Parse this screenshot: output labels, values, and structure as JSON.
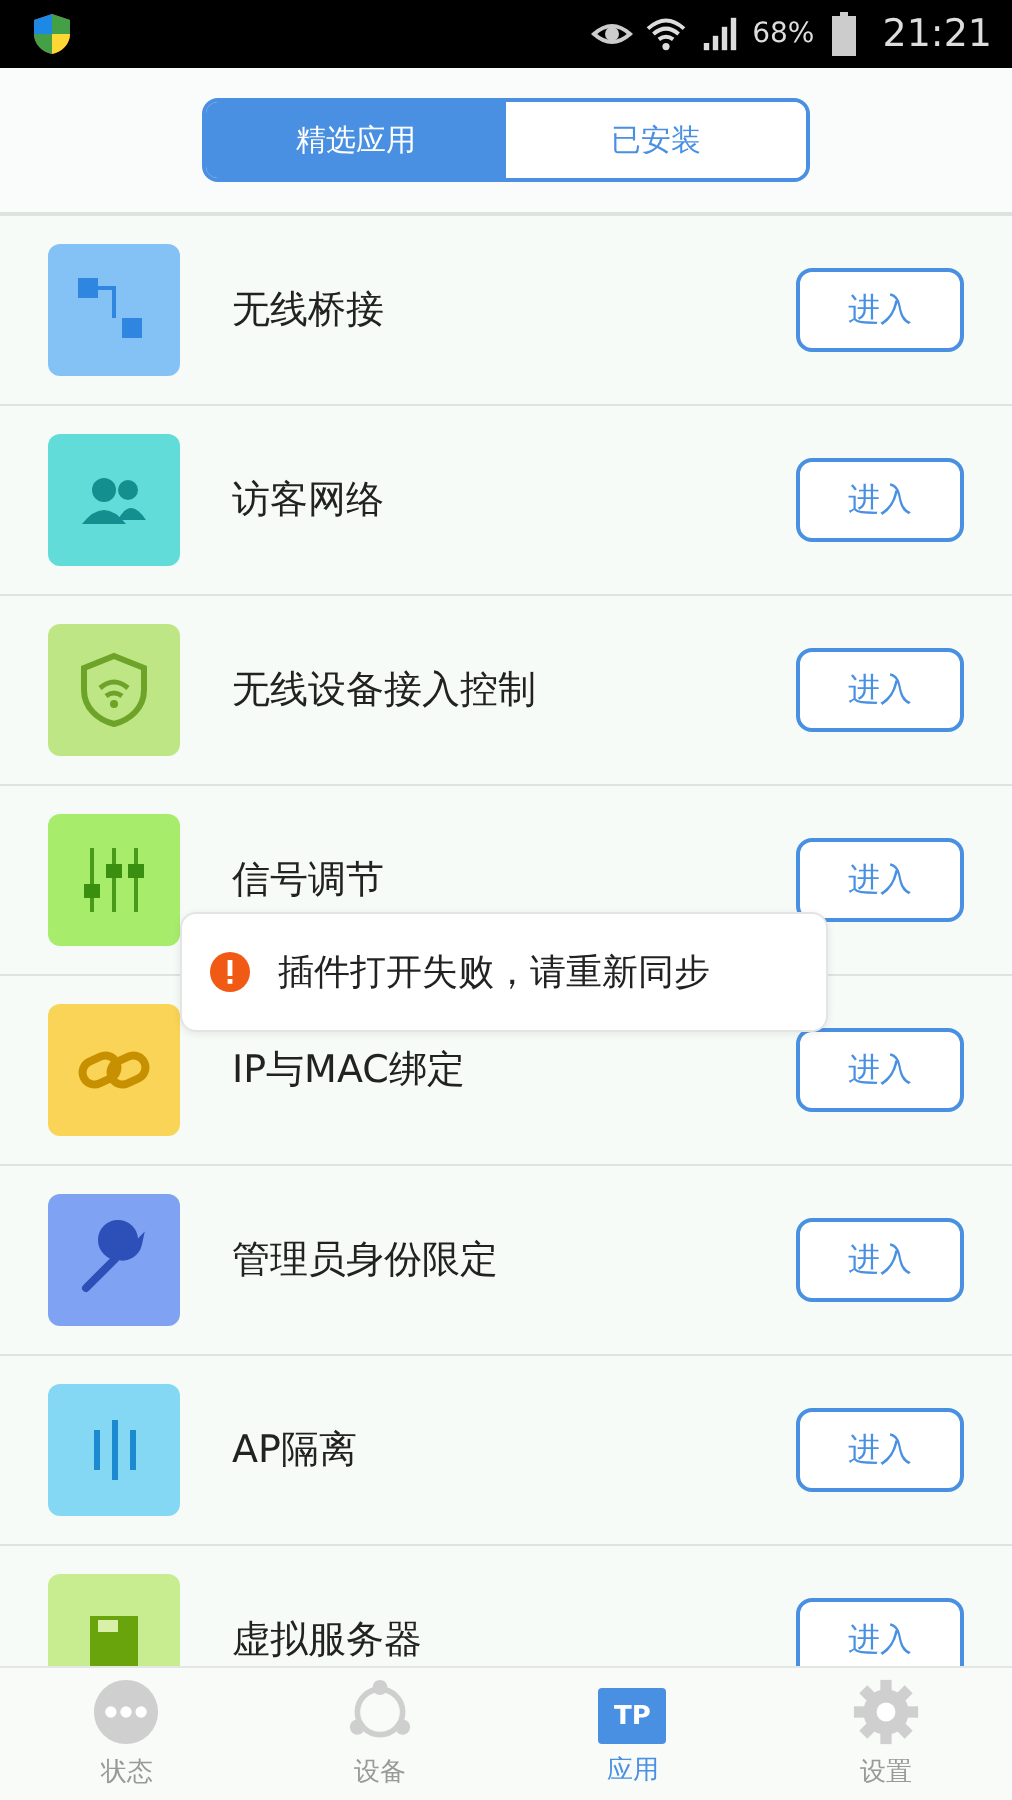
{
  "status_bar": {
    "battery": "68%",
    "time": "21:21"
  },
  "tabs": [
    {
      "label": "精选应用",
      "selected": true
    },
    {
      "label": "已安装",
      "selected": false
    }
  ],
  "apps": [
    {
      "name": "无线桥接",
      "button": "进入",
      "color": "#84c2f6"
    },
    {
      "name": "访客网络",
      "button": "进入",
      "color": "#62dcd8"
    },
    {
      "name": "无线设备接入控制",
      "button": "进入",
      "color": "#bfe684"
    },
    {
      "name": "信号调节",
      "button": "进入",
      "color": "#a8ec6c"
    },
    {
      "name": "IP与MAC绑定",
      "button": "进入",
      "color": "#fad456"
    },
    {
      "name": "管理员身份限定",
      "button": "进入",
      "color": "#7fa2f2"
    },
    {
      "name": "AP隔离",
      "button": "进入",
      "color": "#84d8f4"
    },
    {
      "name": "虚拟服务器",
      "button": "进入",
      "color": "#c8ec90"
    }
  ],
  "toast": {
    "message": "插件打开失败，请重新同步"
  },
  "nav": [
    {
      "label": "状态",
      "selected": false
    },
    {
      "label": "设备",
      "selected": false
    },
    {
      "label": "应用",
      "selected": true,
      "icon_text": "TP"
    },
    {
      "label": "设置",
      "selected": false
    }
  ]
}
